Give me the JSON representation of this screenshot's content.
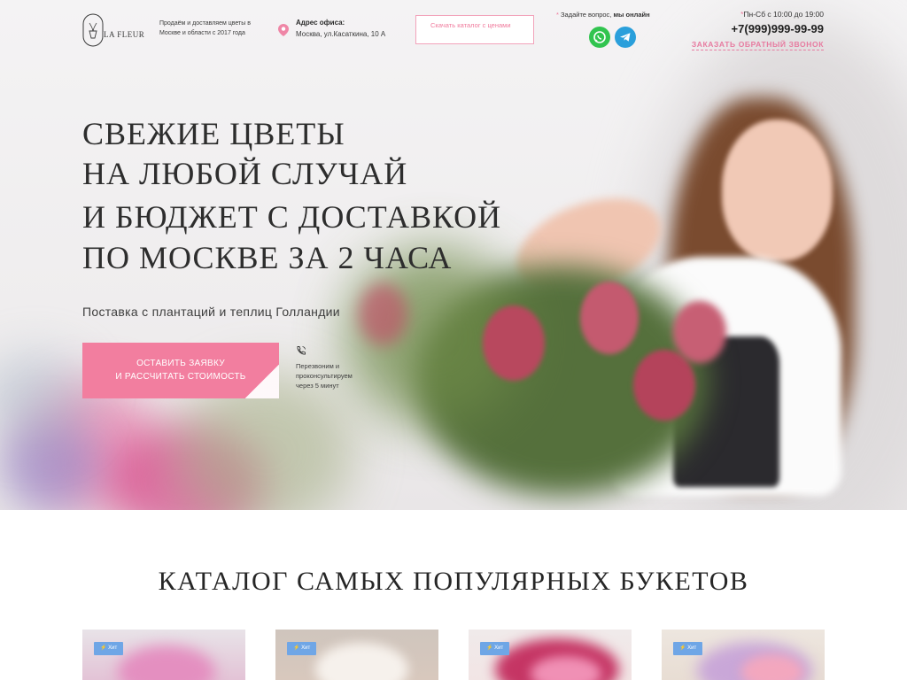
{
  "header": {
    "logo_text": "LA FLEUR",
    "tagline": "Продаём и доставляем цветы в Москве и области с 2017 года",
    "address_title": "Адрес офиса:",
    "address": "Москва, ул.Касаткина, 10 А",
    "catalog_button": "Скачать каталог с ценами",
    "ask_prefix": "Задайте вопрос,",
    "ask_online": "мы онлайн",
    "hours": "Пн-Сб с 10:00 до 19:00",
    "phone": "+7(999)999-99-99",
    "callback": "ЗАКАЗАТЬ ОБРАТНЫЙ ЗВОНОК"
  },
  "hero": {
    "headline": [
      "СВЕЖИЕ ЦВЕТЫ",
      "НА ЛЮБОЙ СЛУЧАЙ",
      "И БЮДЖЕТ С ДОСТАВКОЙ",
      "ПО МОСКВЕ ЗА 2 ЧАСА"
    ],
    "subtitle": "Поставка с плантаций и теплиц Голландии",
    "cta_line1": "ОСТАВИТЬ ЗАЯВКУ",
    "cta_line2": "И РАССЧИТАТЬ СТОИМОСТЬ",
    "cta_note": "Перезвоним и проконсультируем через 5 минут"
  },
  "catalog": {
    "title": "КАТАЛОГ САМЫХ ПОПУЛЯРНЫХ БУКЕТОВ",
    "cards": [
      {
        "badge": "Хит"
      },
      {
        "badge": "Хит"
      },
      {
        "badge": "Хит"
      },
      {
        "badge": "Хит"
      }
    ]
  },
  "colors": {
    "accent": "#f27e9f",
    "badge": "#6fa6e6",
    "whatsapp": "#31c44f",
    "telegram": "#2a9fdb"
  },
  "icons": [
    "logo-icon",
    "map-pin-icon",
    "whatsapp-icon",
    "telegram-icon",
    "phone-handset-icon"
  ]
}
